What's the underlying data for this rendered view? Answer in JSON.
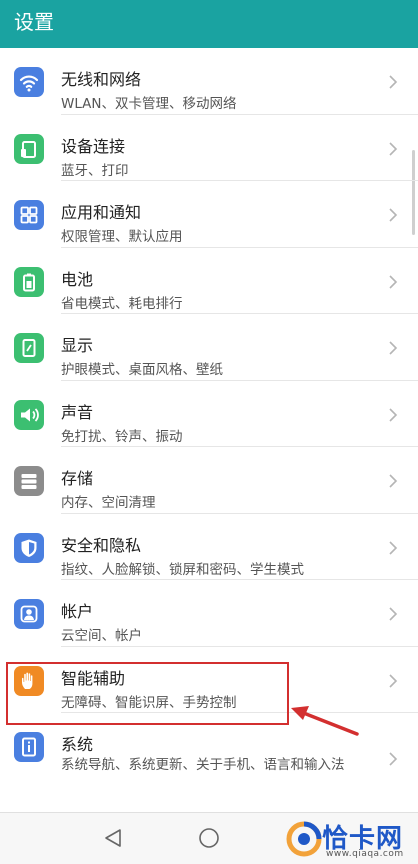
{
  "header": {
    "title": "设置"
  },
  "settings": [
    {
      "title": "无线和网络",
      "subtitle": "WLAN、双卡管理、移动网络",
      "icon": "wifi-icon",
      "color": "#4a7fe0"
    },
    {
      "title": "设备连接",
      "subtitle": "蓝牙、打印",
      "icon": "device-connection-icon",
      "color": "#3cbf71"
    },
    {
      "title": "应用和通知",
      "subtitle": "权限管理、默认应用",
      "icon": "apps-icon",
      "color": "#4a7fe0"
    },
    {
      "title": "电池",
      "subtitle": "省电模式、耗电排行",
      "icon": "battery-icon",
      "color": "#3cbf71"
    },
    {
      "title": "显示",
      "subtitle": "护眼模式、桌面风格、壁纸",
      "icon": "display-icon",
      "color": "#3cbf71"
    },
    {
      "title": "声音",
      "subtitle": "免打扰、铃声、振动",
      "icon": "sound-icon",
      "color": "#3cbf71"
    },
    {
      "title": "存储",
      "subtitle": "内存、空间清理",
      "icon": "storage-icon",
      "color": "#8c8c8c"
    },
    {
      "title": "安全和隐私",
      "subtitle": "指纹、人脸解锁、锁屏和密码、学生模式",
      "icon": "shield-icon",
      "color": "#4a7fe0"
    },
    {
      "title": "帐户",
      "subtitle": "云空间、帐户",
      "icon": "account-icon",
      "color": "#4a7fe0"
    },
    {
      "title": "智能辅助",
      "subtitle": "无障碍、智能识屏、手势控制",
      "icon": "hand-icon",
      "color": "#f08a24"
    },
    {
      "title": "系统",
      "subtitle": "系统导航、系统更新、关于手机、语言和输入法",
      "icon": "system-info-icon",
      "color": "#4a7fe0"
    }
  ],
  "annotation": {
    "highlight_color": "#d32f2f"
  },
  "navbar": {
    "back_icon": "back-triangle-icon",
    "home_icon": "home-circle-icon"
  },
  "watermark": {
    "text": "恰卡网",
    "url": "www.qiaqa.com"
  },
  "colors": {
    "header_bg": "#1aa3a1",
    "text_primary": "#222222",
    "text_secondary": "#555555"
  }
}
